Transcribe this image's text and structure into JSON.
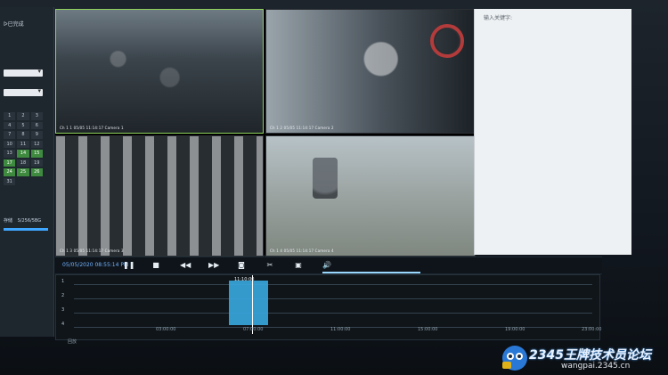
{
  "left_panel": {
    "label_top": "ᐅ已完成",
    "calendar_days": [
      "1",
      "2",
      "3",
      "4",
      "5",
      "6",
      "7",
      "8",
      "9",
      "10",
      "11",
      "12",
      "13",
      "14",
      "15",
      "17",
      "18",
      "19",
      "24",
      "25",
      "26",
      "31"
    ],
    "calendar_highlight": [
      "14",
      "15",
      "17",
      "24",
      "25",
      "26"
    ],
    "storage_label": "存储",
    "storage_value": "S/256/5BG"
  },
  "video_tiles": [
    {
      "label": "Ch 1 1 05/05 11:14:17 Camera 1"
    },
    {
      "label": "Ch 1 2 05/05 11:14:17 Camera 2"
    },
    {
      "label": "Ch 1 3 05/05 11:14:17 Camera 3"
    },
    {
      "label": "Ch 1 4 05/05 11:14:17 Camera 4"
    }
  ],
  "right_panel": {
    "placeholder": "输入关键字:"
  },
  "controls": {
    "time": "05/05/2020 08:55:14 PM",
    "icons": [
      "pause-icon",
      "stop-icon",
      "rewind-icon",
      "fast-forward-icon",
      "camera-icon",
      "cut-icon",
      "record-icon",
      "volume-icon"
    ]
  },
  "timeline": {
    "rows": [
      "1",
      "2",
      "3",
      "4"
    ],
    "clip_label": "11:10:00",
    "ticks": [
      "03:00:00",
      "07:00:00",
      "11:00:00",
      "15:00:00",
      "19:00:00",
      "23:00:00"
    ]
  },
  "footer": {
    "logo_text": "2345王牌技术员论坛",
    "logo_url": "wangpai.2345.cn",
    "corner": "回放"
  }
}
